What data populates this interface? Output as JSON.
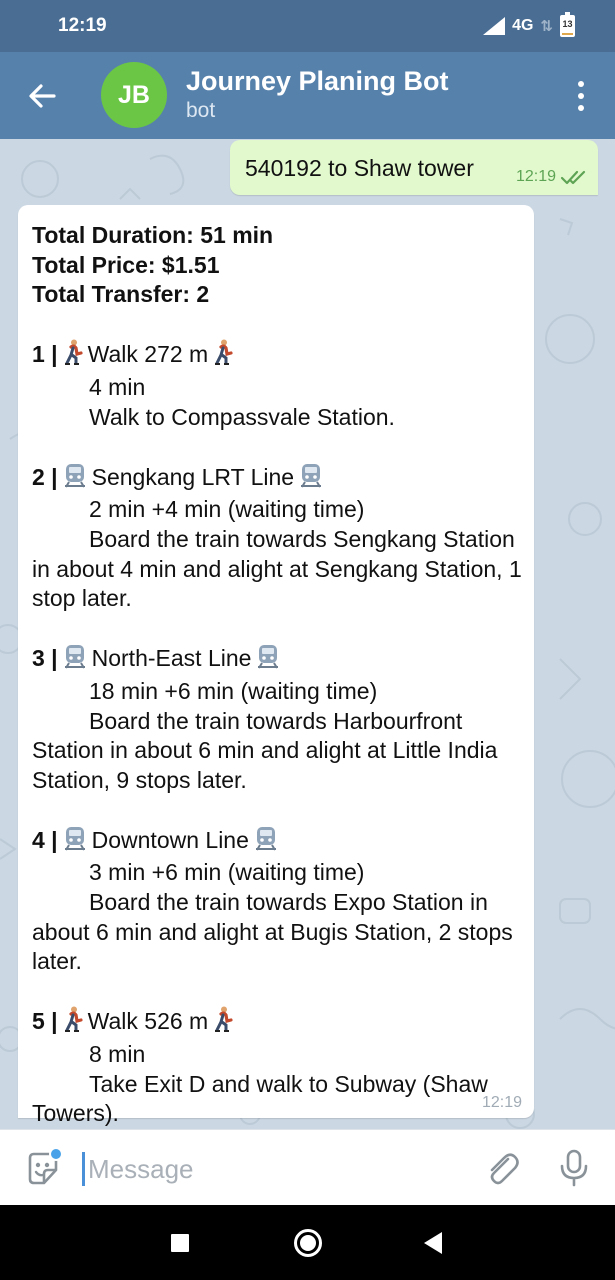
{
  "status_bar": {
    "time": "12:19",
    "network": "4G",
    "battery": "13",
    "battery_level": 0.13
  },
  "header": {
    "avatar_initials": "JB",
    "title": "Journey Planing Bot",
    "subtitle": "bot"
  },
  "messages": {
    "outgoing": {
      "text": "540192 to Shaw tower",
      "time": "12:19"
    },
    "incoming": {
      "summary": {
        "duration": "Total Duration: 51 min",
        "price": "Total Price: $1.51",
        "transfer": "Total Transfer: 2"
      },
      "steps": [
        {
          "number": "1 |",
          "icon": "walking-person-icon",
          "title": "Walk 272 m",
          "duration": "4 min",
          "detail_first": "Walk to Compassvale Station.",
          "detail_rest": ""
        },
        {
          "number": "2 |",
          "icon": "train-icon",
          "title": "Sengkang LRT Line",
          "duration": "2 min +4 min (waiting time)",
          "detail_first": "Board the train towards Sengkang",
          "detail_rest": "Station in about 4 min and alight at Sengkang Station, 1 stop later."
        },
        {
          "number": "3 |",
          "icon": "train-icon",
          "title": "North-East Line",
          "duration": "18 min +6 min (waiting time)",
          "detail_first": "Board the train towards Harbourfront",
          "detail_rest": "Station in about 6 min and alight at Little India Station, 9 stops later."
        },
        {
          "number": "4 |",
          "icon": "train-icon",
          "title": "Downtown Line",
          "duration": "3 min +6 min (waiting time)",
          "detail_first": "Board the train towards Expo Station",
          "detail_rest": "in about 6 min and alight at Bugis Station, 2 stops later."
        },
        {
          "number": "5 |",
          "icon": "walking-person-icon",
          "title": "Walk 526 m",
          "duration": "8 min",
          "detail_first": "Take Exit D and walk to Subway (Shaw",
          "detail_rest": "Towers)."
        }
      ],
      "time": "12:19"
    }
  },
  "input": {
    "placeholder": "Message"
  },
  "colors": {
    "header": "#5681ab",
    "status_bar": "#4a6e93",
    "outgoing_bubble": "#e2f9cd",
    "incoming_bubble": "#ffffff",
    "chat_background": "#cbd7e2",
    "avatar": "#6bc645",
    "read_check": "#5ea455"
  }
}
